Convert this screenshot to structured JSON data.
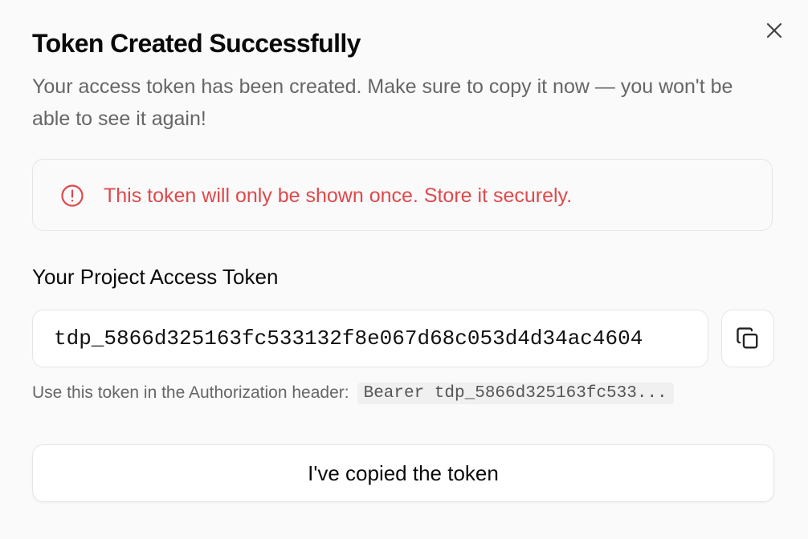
{
  "dialog": {
    "title": "Token Created Successfully",
    "description": "Your access token has been created. Make sure to copy it now — you won't be able to see it again!",
    "close_icon": "x-icon"
  },
  "alert": {
    "icon": "alert-circle-icon",
    "text": "This token will only be shown once. Store it securely.",
    "color": "#e0484b"
  },
  "token": {
    "label": "Your Project Access Token",
    "value": "tdp_5866d325163fc533132f8e067d68c053d4d34ac4604",
    "copy_icon": "copy-icon",
    "hint_label": "Use this token in the Authorization header:",
    "hint_code": "Bearer tdp_5866d325163fc533..."
  },
  "actions": {
    "confirm_label": "I've copied the token"
  }
}
